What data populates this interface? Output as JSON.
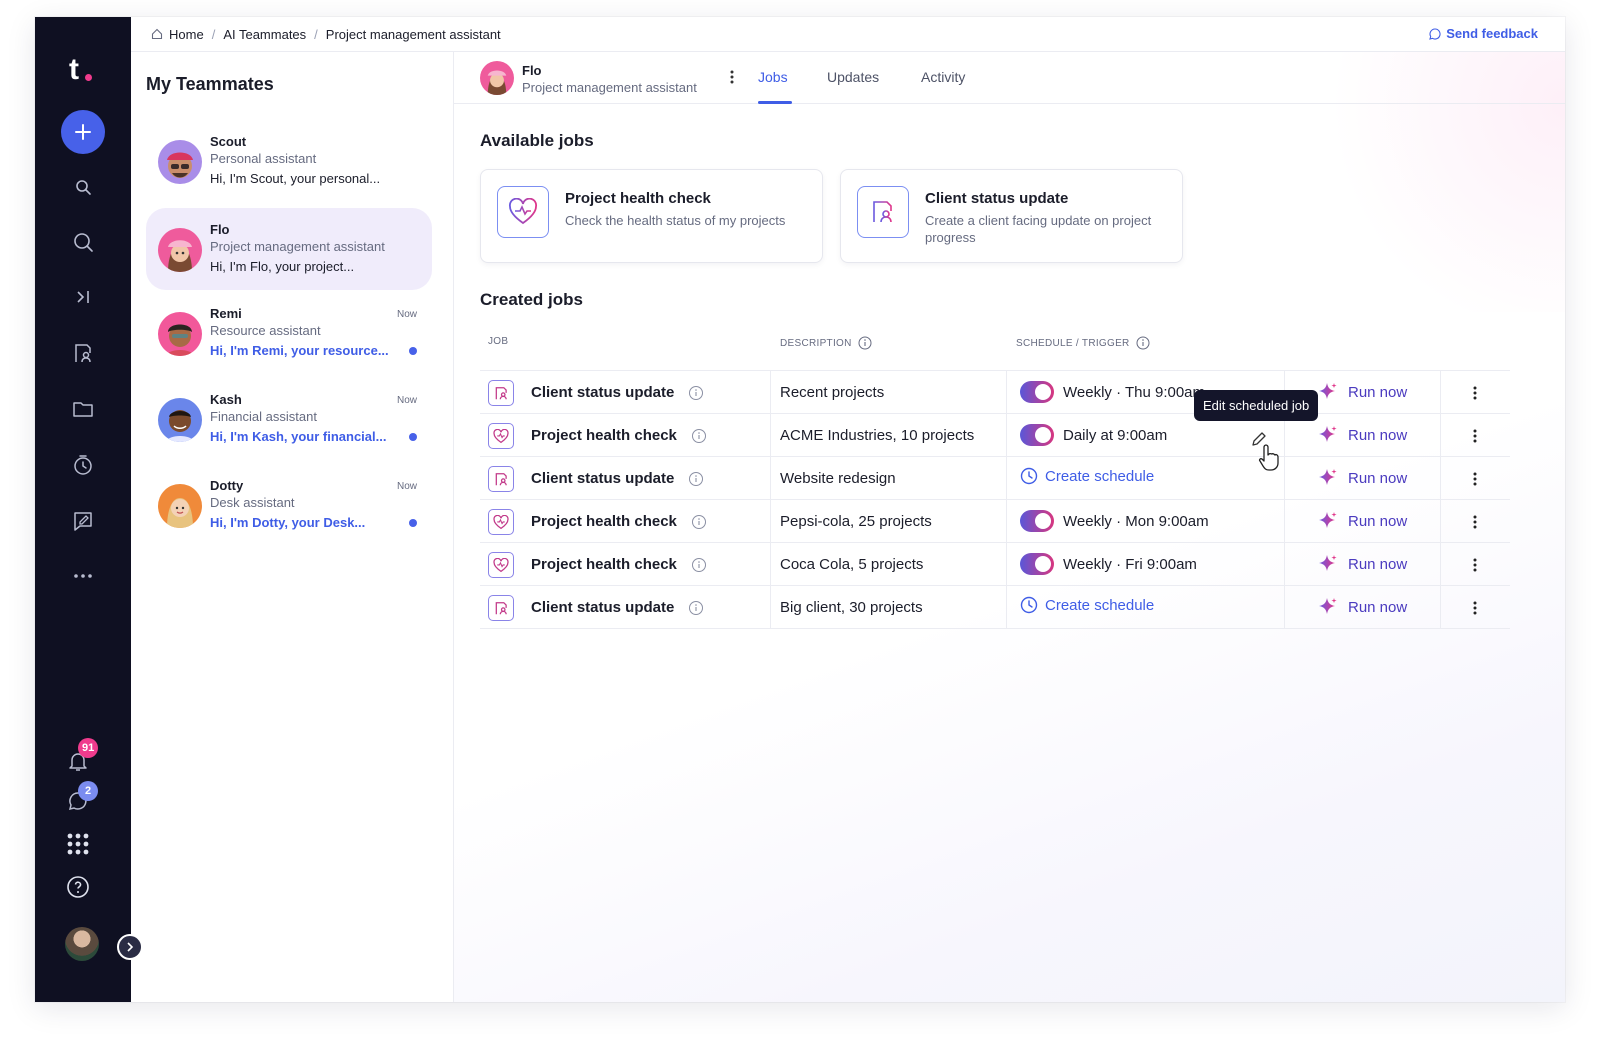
{
  "breadcrumb": [
    "Home",
    "AI Teammates",
    "Project management assistant"
  ],
  "feedback_label": "Send feedback",
  "rail": {
    "notifications_count": "91",
    "messages_count": "2",
    "colors": {
      "rail_bg": "#0f1022",
      "accent": "#4761e9",
      "notif_badge": "#f03b8d",
      "msg_badge": "#7b8cf0"
    }
  },
  "teammates": {
    "title": "My Teammates",
    "items": [
      {
        "name": "Scout",
        "role": "Personal assistant",
        "message": "Hi, I'm Scout, your personal...",
        "time": "",
        "unread": false
      },
      {
        "name": "Flo",
        "role": "Project management assistant",
        "message": "Hi, I'm Flo, your project...",
        "time": "",
        "unread": false
      },
      {
        "name": "Remi",
        "role": "Resource assistant",
        "message": "Hi, I'm Remi, your resource...",
        "time": "Now",
        "unread": true
      },
      {
        "name": "Kash",
        "role": "Financial assistant",
        "message": "Hi, I'm Kash, your financial...",
        "time": "Now",
        "unread": true
      },
      {
        "name": "Dotty",
        "role": "Desk assistant",
        "message": "Hi, I'm Dotty, your Desk...",
        "time": "Now",
        "unread": true
      }
    ]
  },
  "header": {
    "name": "Flo",
    "role": "Project management assistant",
    "tabs": [
      "Jobs",
      "Updates",
      "Activity"
    ],
    "active_tab": "Jobs"
  },
  "available_jobs": {
    "title": "Available jobs",
    "cards": [
      {
        "title": "Project health check",
        "description": "Check the health status of my projects",
        "icon": "heart-pulse-icon"
      },
      {
        "title": "Client status update",
        "description": "Create a client facing update on project progress",
        "icon": "client-report-icon"
      }
    ]
  },
  "created_jobs": {
    "title": "Created jobs",
    "columns": [
      "JOB",
      "DESCRIPTION",
      "SCHEDULE / TRIGGER"
    ],
    "run_label": "Run now",
    "create_schedule_label": "Create schedule",
    "tooltip": "Edit scheduled job",
    "rows": [
      {
        "job": "Client status update",
        "description": "Recent projects",
        "schedule": "Weekly · Thu 9:00am",
        "scheduled": true,
        "icon": "client-report-icon"
      },
      {
        "job": "Project health check",
        "description": "ACME Industries, 10 projects",
        "schedule": "Daily at 9:00am",
        "scheduled": true,
        "icon": "heart-pulse-icon"
      },
      {
        "job": "Client status update",
        "description": "Website redesign",
        "schedule": "",
        "scheduled": false,
        "icon": "client-report-icon"
      },
      {
        "job": "Project health check",
        "description": "Pepsi-cola, 25 projects",
        "schedule": "Weekly · Mon 9:00am",
        "scheduled": true,
        "icon": "heart-pulse-icon"
      },
      {
        "job": "Project health check",
        "description": "Coca Cola, 5 projects",
        "schedule": "Weekly · Fri 9:00am",
        "scheduled": true,
        "icon": "heart-pulse-icon"
      },
      {
        "job": "Client status update",
        "description": "Big client, 30 projects",
        "schedule": "",
        "scheduled": false,
        "icon": "client-report-icon"
      }
    ]
  }
}
